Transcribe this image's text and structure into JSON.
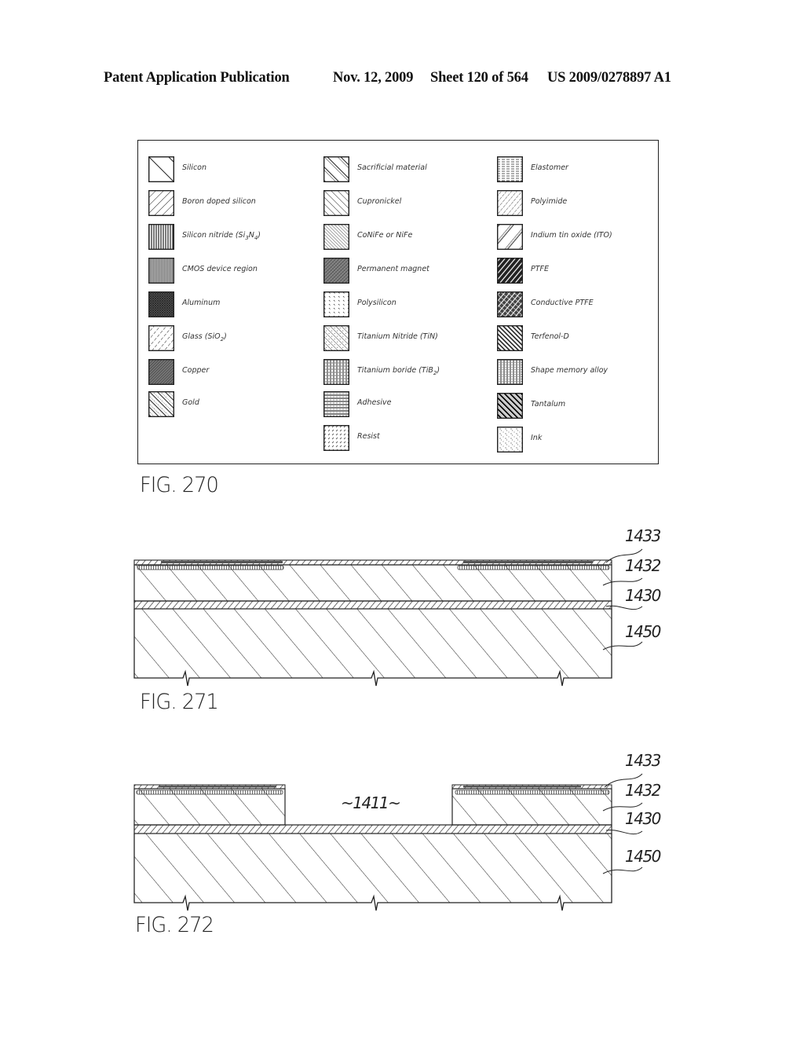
{
  "header": {
    "publication": "Patent Application Publication",
    "date": "Nov. 12, 2009",
    "sheet": "Sheet 120 of 564",
    "number": "US 2009/0278897 A1"
  },
  "fig270": {
    "label": "FIG. 270",
    "legend": [
      {
        "name": "Silicon",
        "pattern": "silicon-hatch"
      },
      {
        "name": "Boron doped silicon",
        "pattern": "diagonal-hatch"
      },
      {
        "name": "Silicon nitride (Si3N4)",
        "pattern": "vertical-lines"
      },
      {
        "name": "CMOS device region",
        "pattern": "vertical-gray"
      },
      {
        "name": "Aluminum",
        "pattern": "dense-crosshatch"
      },
      {
        "name": "Glass (SiO2)",
        "pattern": "dashed-diagonal"
      },
      {
        "name": "Copper",
        "pattern": "dense-diagonal"
      },
      {
        "name": "Gold",
        "pattern": "double-diagonal"
      },
      {
        "name": "Sacrificial material",
        "pattern": "wide-back-diagonal"
      },
      {
        "name": "Cupronickel",
        "pattern": "back-diagonal"
      },
      {
        "name": "CoNiFe or NiFe",
        "pattern": "dense-back-diagonal"
      },
      {
        "name": "Permanent magnet",
        "pattern": "crosshatch-diagonal"
      },
      {
        "name": "Polysilicon",
        "pattern": "dotted"
      },
      {
        "name": "Titanium Nitride (TiN)",
        "pattern": "back-diagonal-dots"
      },
      {
        "name": "Titanium boride (TiB2)",
        "pattern": "vertical-dashed"
      },
      {
        "name": "Adhesive",
        "pattern": "horizontal-lines"
      },
      {
        "name": "Resist",
        "pattern": "short-dashes"
      },
      {
        "name": "Elastomer",
        "pattern": "horizontal-dashed"
      },
      {
        "name": "Polyimide",
        "pattern": "diagonal-dotted"
      },
      {
        "name": "Indium tin oxide (ITO)",
        "pattern": "sparse-diagonal"
      },
      {
        "name": "PTFE",
        "pattern": "heavy-diagonal"
      },
      {
        "name": "Conductive PTFE",
        "pattern": "heavy-diagonal-grid"
      },
      {
        "name": "Terfenol-D",
        "pattern": "heavy-back-diagonal"
      },
      {
        "name": "Shape memory alloy",
        "pattern": "vertical-dotted"
      },
      {
        "name": "Tantalum",
        "pattern": "heavy-back-diagonal-2"
      },
      {
        "name": "Ink",
        "pattern": "speckle"
      }
    ]
  },
  "fig271": {
    "label": "FIG. 271",
    "refs": [
      "1433",
      "1432",
      "1430",
      "1450"
    ]
  },
  "fig272": {
    "label": "FIG. 272",
    "refs": [
      "1433",
      "1432",
      "1430",
      "1450"
    ],
    "opening": "~1411~"
  }
}
